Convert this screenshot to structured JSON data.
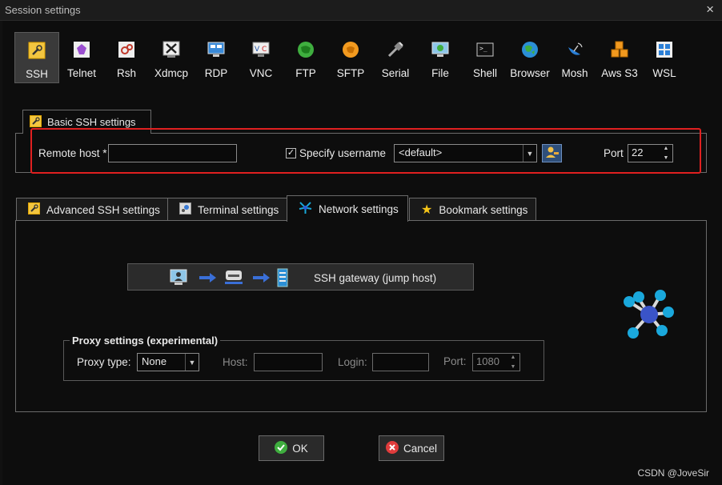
{
  "window": {
    "title": "Session settings",
    "close_icon": "×"
  },
  "protocols": [
    {
      "label": "SSH",
      "icon": "wrench-icon",
      "active": true
    },
    {
      "label": "Telnet",
      "icon": "telnet-icon"
    },
    {
      "label": "Rsh",
      "icon": "rsh-icon"
    },
    {
      "label": "Xdmcp",
      "icon": "xdmcp-icon"
    },
    {
      "label": "RDP",
      "icon": "rdp-monitor-icon"
    },
    {
      "label": "VNC",
      "icon": "vnc-icon"
    },
    {
      "label": "FTP",
      "icon": "ftp-globe-icon"
    },
    {
      "label": "SFTP",
      "icon": "sftp-icon"
    },
    {
      "label": "Serial",
      "icon": "serial-plug-icon"
    },
    {
      "label": "File",
      "icon": "file-monitor-icon"
    },
    {
      "label": "Shell",
      "icon": "terminal-icon"
    },
    {
      "label": "Browser",
      "icon": "browser-globe-icon"
    },
    {
      "label": "Mosh",
      "icon": "satellite-dish-icon"
    },
    {
      "label": "Aws S3",
      "icon": "aws-cubes-icon"
    },
    {
      "label": "WSL",
      "icon": "windows-icon"
    }
  ],
  "basic": {
    "tab_label": "Basic SSH settings",
    "remote_host_label": "Remote host *",
    "remote_host_value": "",
    "specify_username_label": "Specify username",
    "specify_username_checked": true,
    "username_value": "<default>",
    "port_label": "Port",
    "port_value": "22"
  },
  "tabs": [
    {
      "label": "Advanced SSH settings",
      "icon": "wrench-icon"
    },
    {
      "label": "Terminal settings",
      "icon": "terminal-settings-icon"
    },
    {
      "label": "Network settings",
      "icon": "network-icon",
      "active": true
    },
    {
      "label": "Bookmark settings",
      "icon": "star-icon"
    }
  ],
  "network": {
    "gateway_label": "SSH gateway (jump host)",
    "proxy_legend": "Proxy settings (experimental)",
    "proxy_type_label": "Proxy type:",
    "proxy_type_value": "None",
    "host_label": "Host:",
    "host_value": "",
    "login_label": "Login:",
    "login_value": "",
    "port_label": "Port:",
    "port_value": "1080"
  },
  "buttons": {
    "ok_label": "OK",
    "cancel_label": "Cancel"
  },
  "watermark": "CSDN @JoveSir",
  "colors": {
    "highlight_box": "#e02020",
    "accent": "#2f4f7a",
    "network_icon": "#18a8d8"
  }
}
